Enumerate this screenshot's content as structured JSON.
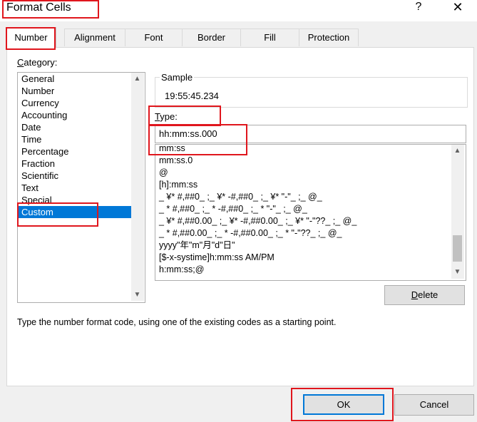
{
  "window": {
    "title": "Format Cells",
    "help_glyph": "?",
    "close_glyph": "✕"
  },
  "tabs": [
    {
      "label": "Number",
      "active": true
    },
    {
      "label": "Alignment",
      "active": false
    },
    {
      "label": "Font",
      "active": false
    },
    {
      "label": "Border",
      "active": false
    },
    {
      "label": "Fill",
      "active": false
    },
    {
      "label": "Protection",
      "active": false
    }
  ],
  "category": {
    "label_first": "C",
    "label_rest": "ategory:",
    "items": [
      "General",
      "Number",
      "Currency",
      "Accounting",
      "Date",
      "Time",
      "Percentage",
      "Fraction",
      "Scientific",
      "Text",
      "Special",
      "Custom"
    ],
    "selected": "Custom"
  },
  "sample": {
    "label": "Sample",
    "value": "19:55:45.234"
  },
  "type": {
    "label_first": "T",
    "label_rest": "ype:",
    "value": "hh:mm:ss.000"
  },
  "formats": [
    "mm:ss",
    "mm:ss.0",
    "@",
    "[h]:mm:ss",
    "_ ¥* #,##0_ ;_ ¥* -#,##0_ ;_ ¥* \"-\"_ ;_ @_",
    "_ * #,##0_ ;_ * -#,##0_ ;_ * \"-\"_ ;_ @_",
    "_ ¥* #,##0.00_ ;_ ¥* -#,##0.00_ ;_ ¥* \"-\"??_ ;_ @_",
    "_ * #,##0.00_ ;_ * -#,##0.00_ ;_ * \"-\"??_ ;_ @_",
    "yyyy\"年\"m\"月\"d\"日\"",
    "[$-x-systime]h:mm:ss AM/PM",
    "h:mm:ss;@"
  ],
  "delete_button": {
    "first": "D",
    "rest": "elete"
  },
  "description": "Type the number format code, using one of the existing codes as a starting point.",
  "ok_label": "OK",
  "cancel_label": "Cancel",
  "colors": {
    "selection": "#0078d7",
    "highlight": "#e0161d"
  }
}
